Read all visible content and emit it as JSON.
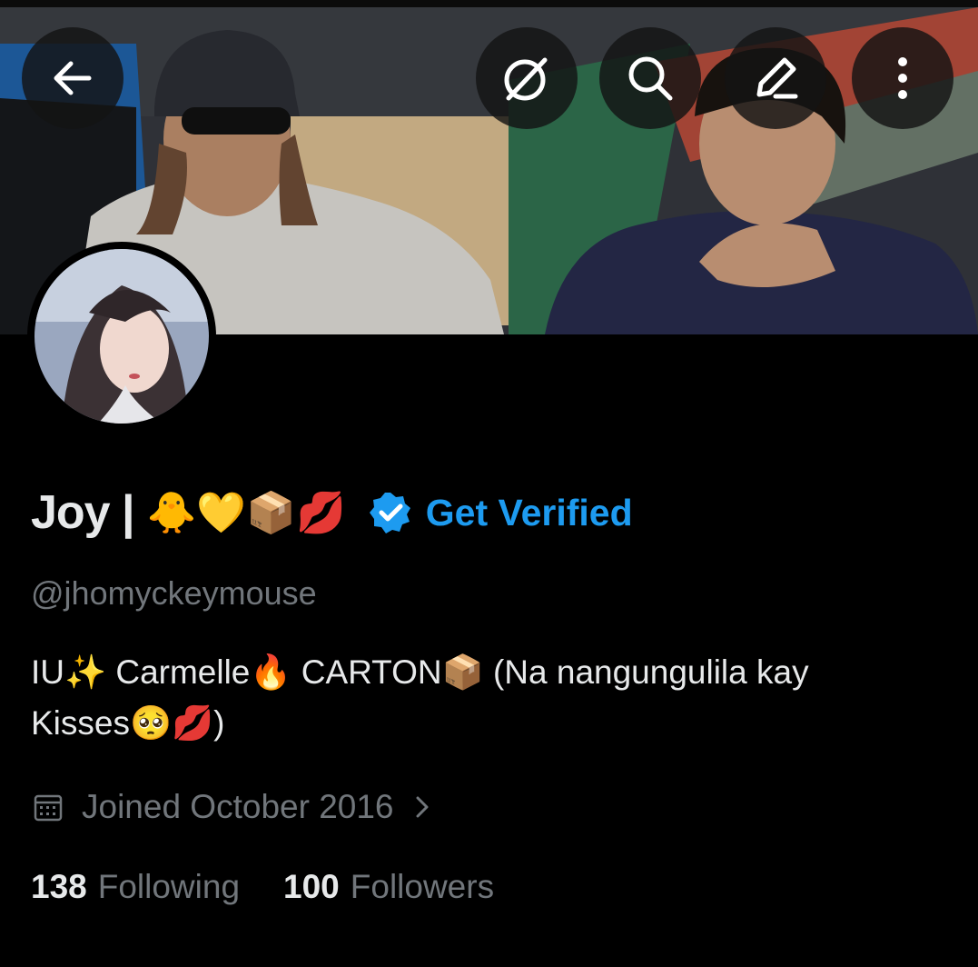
{
  "header": {
    "back_icon": "arrow-left-icon",
    "grok_icon": "grok-icon",
    "search_icon": "search-icon",
    "edit_icon": "pencil-icon",
    "more_icon": "more-vertical-icon"
  },
  "profile": {
    "display_name": "Joy |",
    "name_emojis": "🐥💛📦💋",
    "verified_icon": "verified-badge-icon",
    "get_verified_label": "Get Verified",
    "handle": "@jhomyckeymouse",
    "bio_line1": "IU✨ Carmelle🔥 CARTON📦 (Na nangungulila kay",
    "bio_line2": "Kisses🥺💋)",
    "joined": "Joined October 2016",
    "following_count": "138",
    "following_label": "Following",
    "followers_count": "100",
    "followers_label": "Followers"
  },
  "colors": {
    "background": "#000000",
    "text_primary": "#e7e9ea",
    "text_secondary": "#71767b",
    "accent": "#1d9bf0"
  }
}
